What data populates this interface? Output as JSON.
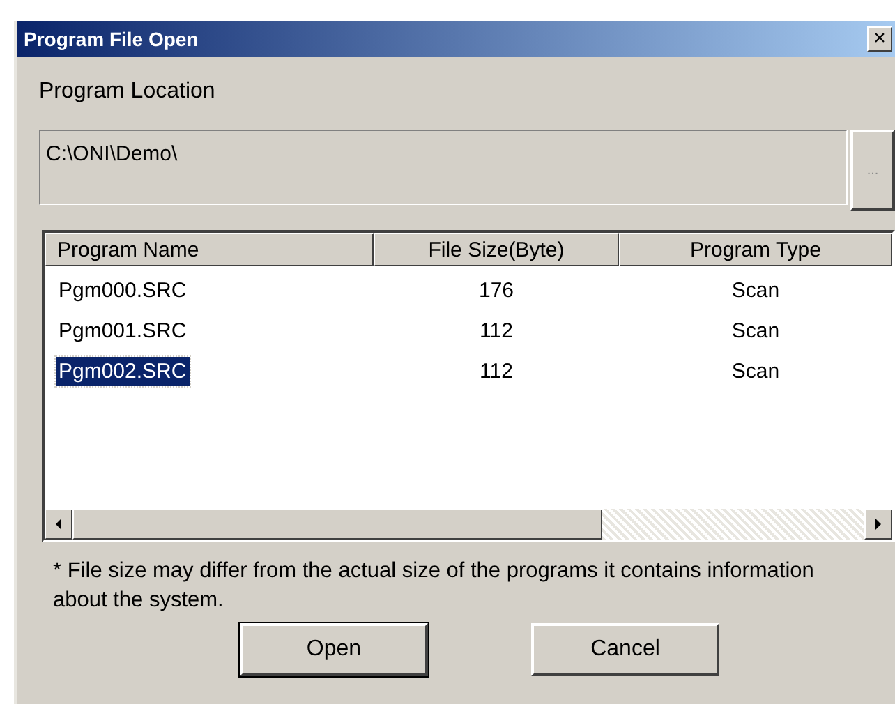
{
  "window": {
    "title": "Program File Open",
    "close": "×"
  },
  "location": {
    "label": "Program Location",
    "path": "C:\\ONI\\Demo\\",
    "browse": "..."
  },
  "table": {
    "columns": [
      "Program Name",
      "File Size(Byte)",
      "Program Type"
    ],
    "rows": [
      {
        "name": "Pgm000.SRC",
        "size": "176",
        "type": "Scan",
        "selected": false
      },
      {
        "name": "Pgm001.SRC",
        "size": "112",
        "type": "Scan",
        "selected": false
      },
      {
        "name": "Pgm002.SRC",
        "size": "112",
        "type": "Scan",
        "selected": true
      }
    ]
  },
  "note": "* File size may differ from the actual size of the programs it contains information about the system.",
  "buttons": [
    {
      "label": "Open",
      "default": true
    },
    {
      "label": "Cancel",
      "default": false
    }
  ]
}
